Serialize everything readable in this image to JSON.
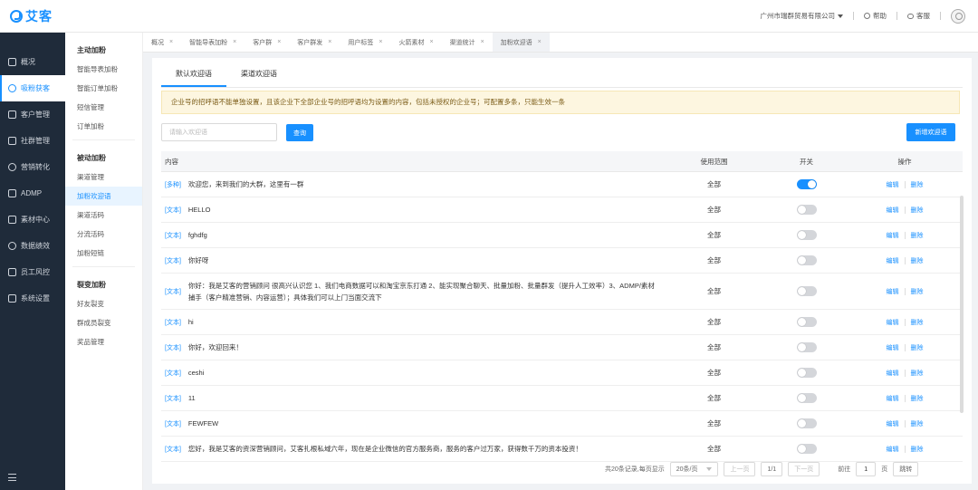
{
  "app": {
    "logo_text": "艾客"
  },
  "header": {
    "company": "广州市瑞群贸易有限公司",
    "help": "帮助",
    "service": "客服"
  },
  "sidebar": {
    "items": [
      {
        "label": "概况",
        "icon": "home-icon"
      },
      {
        "label": "吸粉获客",
        "icon": "user-add-icon",
        "active": true
      },
      {
        "label": "客户管理",
        "icon": "customer-icon"
      },
      {
        "label": "社群管理",
        "icon": "group-icon"
      },
      {
        "label": "营销转化",
        "icon": "marketing-icon"
      },
      {
        "label": "ADMP",
        "icon": "admp-icon"
      },
      {
        "label": "素材中心",
        "icon": "material-icon"
      },
      {
        "label": "数据绩效",
        "icon": "chart-icon"
      },
      {
        "label": "员工风控",
        "icon": "shield-icon"
      },
      {
        "label": "系统设置",
        "icon": "gear-icon"
      }
    ]
  },
  "subnav": {
    "groups": [
      {
        "title": "主动加粉",
        "items": [
          "智能导表加粉",
          "智能订单加粉",
          "短信管理",
          "订单加粉"
        ]
      },
      {
        "title": "被动加粉",
        "items": [
          "渠道管理",
          "加粉欢迎语",
          "渠道活码",
          "分流活码",
          "加粉短链"
        ]
      },
      {
        "title": "裂变加粉",
        "items": [
          "好友裂变",
          "群成员裂变",
          "奖品管理"
        ]
      }
    ],
    "active": "加粉欢迎语"
  },
  "tabs": [
    {
      "label": "概况"
    },
    {
      "label": "智能导表加粉"
    },
    {
      "label": "客户群"
    },
    {
      "label": "客户群发"
    },
    {
      "label": "用户标签"
    },
    {
      "label": "火箭素材"
    },
    {
      "label": "渠道统计"
    },
    {
      "label": "加粉欢迎语",
      "active": true
    }
  ],
  "inner_tabs": [
    {
      "label": "默认欢迎语",
      "active": true
    },
    {
      "label": "渠道欢迎语"
    }
  ],
  "notice": "企业号的招呼语不能单独设置，且该企业下全部企业号的招呼语均为设置的内容，包括未授权的企业号；可配置多条，只能生效一条",
  "search": {
    "placeholder": "请输入欢迎语",
    "query_label": "查询",
    "new_label": "新增欢迎语"
  },
  "table": {
    "headers": {
      "content": "内容",
      "range": "使用范围",
      "switch": "开关",
      "action": "操作"
    },
    "action_edit": "编辑",
    "action_delete": "删除",
    "rows": [
      {
        "tag": "[多种]",
        "content": "欢迎您，来到我们的大群，这里有一群",
        "range": "全部",
        "on": true
      },
      {
        "tag": "[文本]",
        "content": "HELLO",
        "range": "全部",
        "on": false
      },
      {
        "tag": "[文本]",
        "content": "fghdfg",
        "range": "全部",
        "on": false
      },
      {
        "tag": "[文本]",
        "content": "你好呀",
        "range": "全部",
        "on": false
      },
      {
        "tag": "[文本]",
        "content": "你好：我是艾客的营销顾问 很高兴认识您 1、我们电商数据可以和淘宝京东打通 2、能实现聚合聊天、批量加粉、批量群发（提升人工效率）3、ADMP/素材捕手（客户精准营销、内容运营）；具体我们可以上门当面交流下",
        "range": "全部",
        "on": false
      },
      {
        "tag": "[文本]",
        "content": "hi",
        "range": "全部",
        "on": false
      },
      {
        "tag": "[文本]",
        "content": "你好，欢迎回来！",
        "range": "全部",
        "on": false
      },
      {
        "tag": "[文本]",
        "content": "ceshi",
        "range": "全部",
        "on": false
      },
      {
        "tag": "[文本]",
        "content": "11",
        "range": "全部",
        "on": false
      },
      {
        "tag": "[文本]",
        "content": "FEWFEW",
        "range": "全部",
        "on": false
      },
      {
        "tag": "[文本]",
        "content": "您好，我是艾客的资深营销顾问，艾客扎根私域六年，现在是企业微信的官方服务商，服务的客户过万家，获得数千万的资本投资！",
        "range": "全部",
        "on": false
      }
    ]
  },
  "pagination": {
    "total": "共20条记录,每页显示",
    "page_size": "20条/页",
    "prev": "上一页",
    "page_of": "1/1",
    "next": "下一页",
    "goto_prefix": "前往",
    "goto_value": "1",
    "goto_suffix": "页",
    "jump": "跳转"
  }
}
